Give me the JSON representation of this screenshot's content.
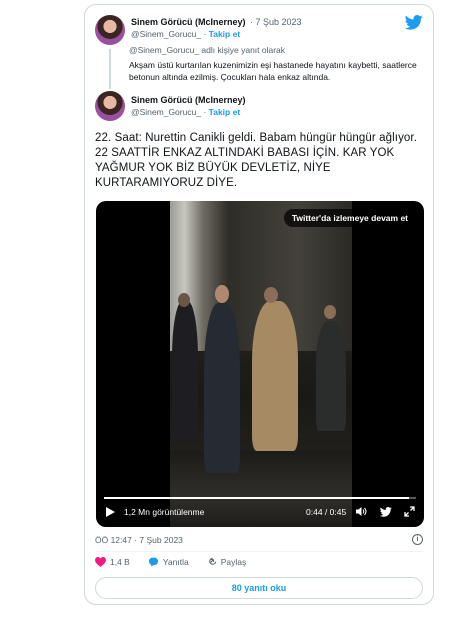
{
  "tweet": {
    "author_name": "Sinem Görücü (McInerney)",
    "author_handle": "@Sinem_Gorucu_",
    "separator": "·",
    "date": "7 Şub 2023",
    "follow_label": "Takip et",
    "main_text": "22. Saat: Nurettin Canikli geldi. Babam hüngür hüngür ağlıyor. 22 SAATTİR ENKAZ ALTINDAKİ BABASI İÇİN. KAR YOK YAĞMUR YOK BİZ BÜYÜK DEVLETİZ, NİYE KURTARAMIYORUZ DİYE.",
    "timestamp": "ÖÖ 12:47 · 7 Şub 2023"
  },
  "quoted": {
    "author_name": "Sinem Görücü (McInerney)",
    "date": "· 7 Şub 2023",
    "author_handle": "@Sinem_Gorucu_",
    "follow_label": "Takip et",
    "reply_context": "@Sinem_Gorucu_ adlı kişiye yanıt olarak",
    "text": "Akşam üstü kurtarılan kuzenimizin eşi hastanede hayatını kaybetti, saatlerce betonun altında ezilmiş. Çocukları hala enkaz altında."
  },
  "video": {
    "cta_label": "Twitter'da izlemeye devam et",
    "views": "1,2 Mn görüntülenme",
    "time": "0:44 / 0:45",
    "progress": 0.978
  },
  "actions": {
    "like_count": "1,4 B",
    "reply_label": "Yanıtla",
    "share_label": "Paylaş"
  },
  "replies_button": "80 yanıtı oku",
  "colors": {
    "accent": "#1d9bf0",
    "like": "#f91880",
    "text_secondary": "#536471"
  },
  "icons": [
    "twitter-logo-icon",
    "play-icon",
    "volume-icon",
    "twitter-bird-icon",
    "fullscreen-icon",
    "info-icon",
    "heart-icon",
    "reply-icon",
    "share-icon"
  ]
}
